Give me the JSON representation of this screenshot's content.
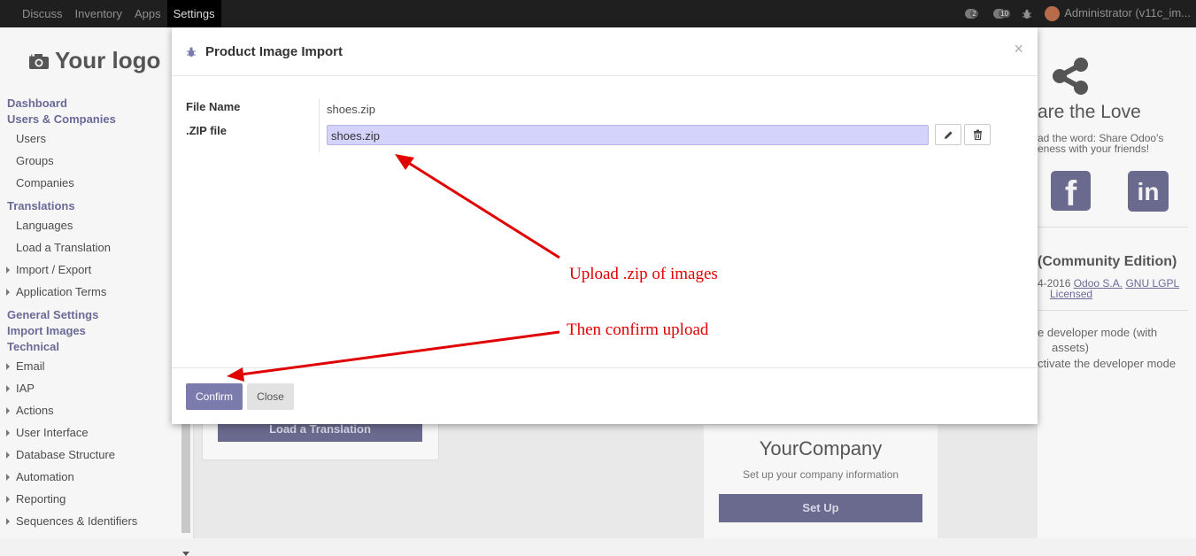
{
  "topbar": {
    "menu": [
      "Discuss",
      "Inventory",
      "Apps",
      "Settings"
    ],
    "active_index": 3,
    "chat_count": "2",
    "activity_count": "10",
    "user": "Administrator (v11c_im..."
  },
  "sidebar": {
    "logo_text": "Your logo",
    "sections": [
      {
        "type": "header",
        "label": "Dashboard"
      },
      {
        "type": "header",
        "label": "Users & Companies"
      },
      {
        "type": "item",
        "label": "Users"
      },
      {
        "type": "item",
        "label": "Groups"
      },
      {
        "type": "item",
        "label": "Companies"
      },
      {
        "type": "header",
        "label": "Translations"
      },
      {
        "type": "item",
        "label": "Languages"
      },
      {
        "type": "item",
        "label": "Load a Translation"
      },
      {
        "type": "collapsible",
        "label": "Import / Export"
      },
      {
        "type": "collapsible",
        "label": "Application Terms"
      },
      {
        "type": "header",
        "label": "General Settings"
      },
      {
        "type": "header",
        "label": "Import Images"
      },
      {
        "type": "header",
        "label": "Technical"
      },
      {
        "type": "collapsible",
        "label": "Email"
      },
      {
        "type": "collapsible",
        "label": "IAP"
      },
      {
        "type": "collapsible",
        "label": "Actions"
      },
      {
        "type": "collapsible",
        "label": "User Interface"
      },
      {
        "type": "collapsible",
        "label": "Database Structure"
      },
      {
        "type": "collapsible",
        "label": "Automation"
      },
      {
        "type": "collapsible",
        "label": "Reporting"
      },
      {
        "type": "collapsible",
        "label": "Sequences & Identifiers"
      }
    ]
  },
  "background": {
    "load_translation_btn": "Load a Translation",
    "company_title": "YourCompany",
    "company_sub": "Set up your company information",
    "setup_btn": "Set Up",
    "share_title": "are the Love",
    "share_sub_line1": "ad the word: Share Odoo's",
    "share_sub_line2": "eness with your friends!",
    "edition": "(Community Edition)",
    "copyright_prefix": "4-2016",
    "odoo_link": "Odoo S.A.",
    "license_link": "GNU LGPL",
    "licensed": "Licensed",
    "dev_mode_1": "e developer mode (with",
    "dev_mode_2": "assets)",
    "dev_mode_3": "ctivate the developer mode",
    "facebook_letter": "f",
    "linkedin_letters": "in"
  },
  "modal": {
    "title": "Product Image Import",
    "close_glyph": "×",
    "file_name_label": "File Name",
    "file_name_value": "shoes.zip",
    "zip_label": ".ZIP file",
    "zip_value": "shoes.zip",
    "confirm_label": "Confirm",
    "close_label": "Close"
  },
  "annotations": {
    "upload_note": "Upload .zip of images",
    "confirm_note": "Then confirm upload",
    "color": "#e00000"
  }
}
